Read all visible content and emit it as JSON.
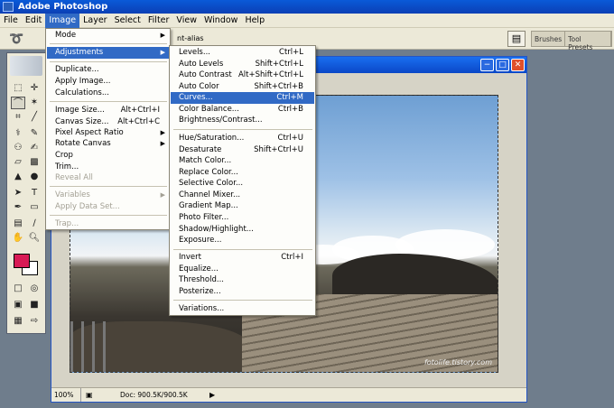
{
  "window": {
    "title": "Adobe Photoshop"
  },
  "menubar": {
    "items": [
      "File",
      "Edit",
      "Image",
      "Layer",
      "Select",
      "Filter",
      "View",
      "Window",
      "Help"
    ],
    "active": "Image"
  },
  "options": {
    "antialias": "nt-alias",
    "palette_well": [
      "Brushes",
      "Tool Presets"
    ]
  },
  "image_menu": {
    "mode": "Mode",
    "adjustments": "Adjustments",
    "duplicate": "Duplicate...",
    "apply_image": "Apply Image...",
    "calculations": "Calculations...",
    "image_size": "Image Size...",
    "image_size_sc": "Alt+Ctrl+I",
    "canvas_size": "Canvas Size...",
    "canvas_size_sc": "Alt+Ctrl+C",
    "pixel_aspect": "Pixel Aspect Ratio",
    "rotate_canvas": "Rotate Canvas",
    "crop": "Crop",
    "trim": "Trim...",
    "reveal_all": "Reveal All",
    "variables": "Variables",
    "apply_data_set": "Apply Data Set...",
    "trap": "Trap..."
  },
  "adjustments_menu": {
    "levels": "Levels...",
    "levels_sc": "Ctrl+L",
    "auto_levels": "Auto Levels",
    "auto_levels_sc": "Shift+Ctrl+L",
    "auto_contrast": "Auto Contrast",
    "auto_contrast_sc": "Alt+Shift+Ctrl+L",
    "auto_color": "Auto Color",
    "auto_color_sc": "Shift+Ctrl+B",
    "curves": "Curves...",
    "curves_sc": "Ctrl+M",
    "color_balance": "Color Balance...",
    "color_balance_sc": "Ctrl+B",
    "brightness_contrast": "Brightness/Contrast...",
    "hue_saturation": "Hue/Saturation...",
    "hue_saturation_sc": "Ctrl+U",
    "desaturate": "Desaturate",
    "desaturate_sc": "Shift+Ctrl+U",
    "match_color": "Match Color...",
    "replace_color": "Replace Color...",
    "selective_color": "Selective Color...",
    "channel_mixer": "Channel Mixer...",
    "gradient_map": "Gradient Map...",
    "photo_filter": "Photo Filter...",
    "shadow_highlight": "Shadow/Highlight...",
    "exposure": "Exposure...",
    "invert": "Invert",
    "invert_sc": "Ctrl+I",
    "equalize": "Equalize...",
    "threshold": "Threshold...",
    "posterize": "Posterize...",
    "variations": "Variations..."
  },
  "status": {
    "zoom": "100%",
    "doc": "Doc: 900.5K/900.5K"
  },
  "canvas": {
    "watermark": "fotolife.tistory.com"
  },
  "colors": {
    "foreground": "#d81a55",
    "background": "#ffffff",
    "highlight": "#316ac5"
  }
}
